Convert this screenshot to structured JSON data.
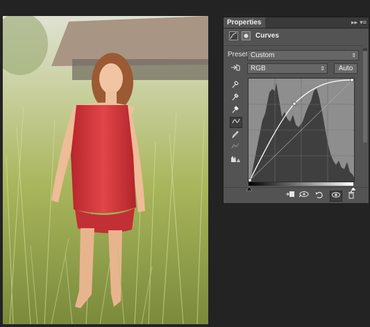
{
  "photo": {
    "subject": "photo"
  },
  "panel": {
    "tab_label": "Properties",
    "tab_arrows": "▸▸",
    "menu_glyph": "▾≡",
    "adjustment_title": "Curves",
    "preset_label": "Preset:",
    "preset_value": "Custom",
    "channel_value": "RGB",
    "auto_label": "Auto"
  },
  "icons": {
    "adjustment": "curves-adjustment-icon",
    "mask": "mask-icon",
    "hand": "targeted-adjustment-hand-icon",
    "eyedropper_black": "sample-black-point-icon",
    "eyedropper_gray": "sample-gray-point-icon",
    "eyedropper_white": "sample-white-point-icon",
    "curve_tool": "edit-points-curve-icon",
    "pencil": "draw-pencil-icon",
    "smooth": "smooth-curve-icon",
    "clipping_warning": "clipping-warning-icon",
    "clip_to_layer": "clip-to-layer-icon",
    "view_previous": "view-previous-state-icon",
    "reset": "reset-icon",
    "visibility": "visibility-eye-icon",
    "delete": "trash-icon"
  },
  "colors": {
    "panel_bg": "#535353",
    "graph_bg": "#8e8e8e",
    "histogram": "#3f3f3f",
    "curve": "#ffffff",
    "dress": "#d8343a"
  }
}
